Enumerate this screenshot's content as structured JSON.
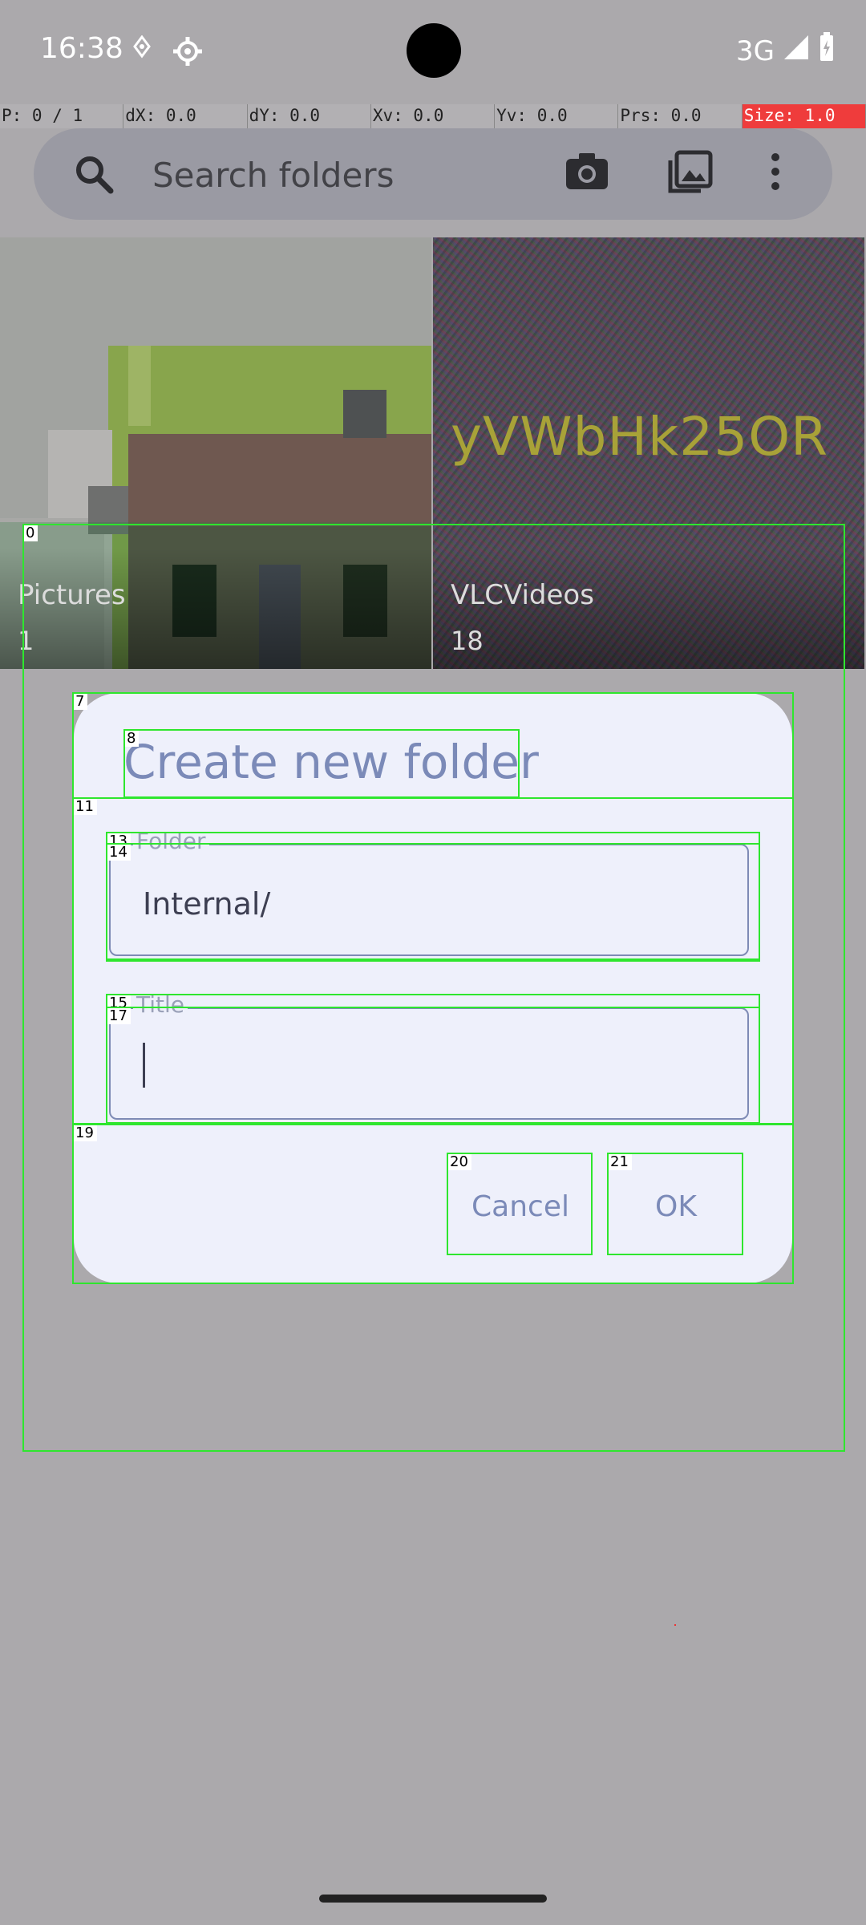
{
  "status_bar": {
    "time": "16:38",
    "network": "3G"
  },
  "debug_bar": {
    "pointer": "P: 0 / 1",
    "dx": "dX: 0.0",
    "dy": "dY: 0.0",
    "xv": "Xv: 0.0",
    "yv": "Yv: 0.0",
    "prs": "Prs: 0.0",
    "size": "Size: 1.0"
  },
  "search": {
    "placeholder": "Search folders"
  },
  "folders": [
    {
      "name": "Pictures",
      "count": "1"
    },
    {
      "name": "VLCVideos",
      "count": "18",
      "thumb_text": "yVWbHk25OR"
    }
  ],
  "dialog": {
    "title": "Create new folder",
    "folder_label": "Folder",
    "folder_value": "Internal/",
    "title_label": "Title",
    "title_value": "",
    "cancel_label": "Cancel",
    "ok_label": "OK"
  },
  "overlay_labels": [
    "0",
    "7",
    "8",
    "11",
    "13",
    "14",
    "15",
    "17",
    "19",
    "20",
    "21"
  ],
  "colors": {
    "accent": "#7b8ab8",
    "dialog_bg": "#eef0fb",
    "overlay": "#2ee62e",
    "scrim": "#aba9ac"
  }
}
